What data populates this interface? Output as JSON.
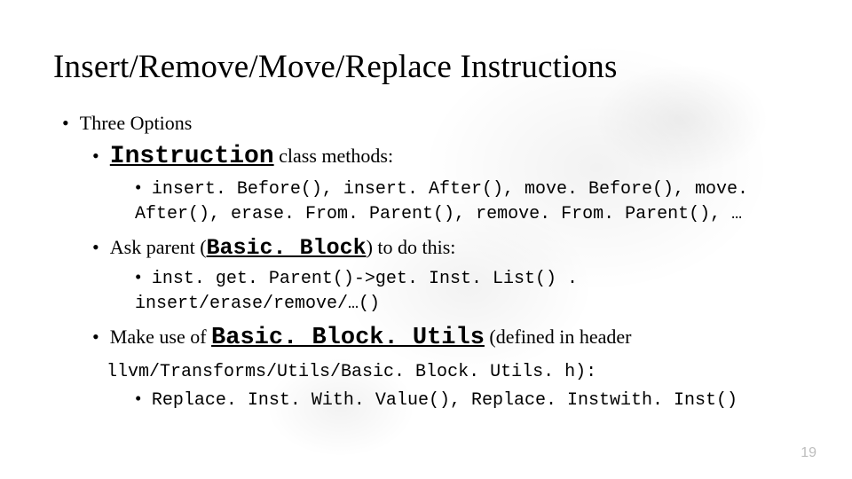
{
  "title": "Insert/Remove/Move/Replace Instructions",
  "lvl1": {
    "text": "Three Options"
  },
  "opt1": {
    "class_name": "Instruction",
    "tail": " class methods:",
    "sub": "insert. Before(), insert. After(), move. Before(), move. After(), erase. From. Parent(), remove. From. Parent(), …"
  },
  "opt2": {
    "lead": "Ask parent (",
    "class_name": "Basic. Block",
    "tail": ") to do this:",
    "sub": "inst. get. Parent()->get. Inst. List() . insert/erase/remove/…()"
  },
  "opt3": {
    "lead": "Make use of ",
    "class_name": "Basic. Block. Utils",
    "tail": " (defined in header",
    "header_path": "llvm/Transforms/Utils/Basic. Block. Utils. h):",
    "sub": "Replace. Inst. With. Value(), Replace. Instwith. Inst()"
  },
  "page_number": "19"
}
